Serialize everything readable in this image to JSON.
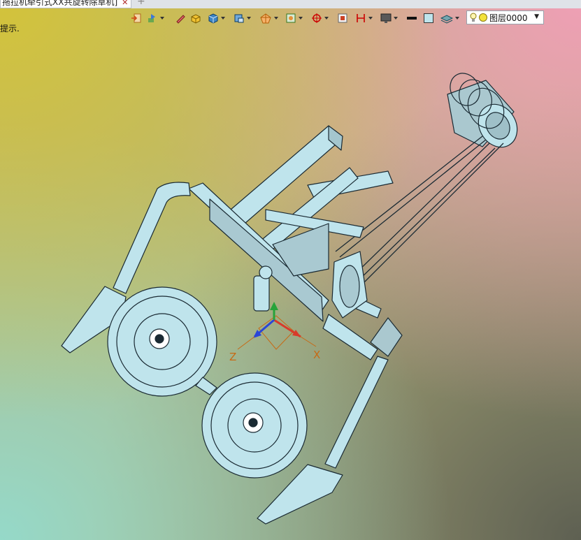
{
  "document_tab": {
    "title": "拖拉机牵引式XX共旋转除草机]",
    "close_glyph": "✕",
    "new_tab_glyph": "+"
  },
  "toolbar": {
    "tools": [
      {
        "icon": "import-icon"
      },
      {
        "icon": "scene-tools-icon",
        "dropdown": true
      },
      {
        "icon": "pen-icon"
      },
      {
        "icon": "solid-box-icon"
      },
      {
        "icon": "cube-icon",
        "dropdown": true
      },
      {
        "icon": "view-box-icon",
        "dropdown": true
      },
      {
        "icon": "render-style-icon",
        "dropdown": true
      },
      {
        "icon": "filter-select-icon",
        "dropdown": true
      },
      {
        "icon": "snap-target-icon",
        "dropdown": true
      },
      {
        "icon": "plane-icon"
      },
      {
        "icon": "measure-icon",
        "dropdown": true
      },
      {
        "icon": "display-icon",
        "dropdown": true
      },
      {
        "icon": "line-color-icon"
      },
      {
        "icon": "face-color-icon"
      },
      {
        "icon": "layer-stack-icon",
        "dropdown": true
      }
    ],
    "line_color": "#111111",
    "face_color": "#bfe4ec"
  },
  "layer_selector": {
    "value": "图层0000",
    "bulb_icon": "lightbulb-icon",
    "status_dot_color": "#f3e23a"
  },
  "hint": {
    "text": "提示."
  },
  "viewport": {
    "triad": {
      "x_label": "X",
      "z_label": "Z",
      "x_color": "#d83a2a",
      "z_color": "#2a45d8",
      "y_color": "#27a33a",
      "label_color": "#c76a14"
    },
    "model_fill": "#bfe4ec",
    "model_stroke": "#1a2a33"
  }
}
